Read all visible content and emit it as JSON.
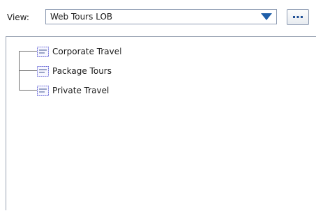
{
  "view": {
    "label": "View:",
    "selected": "Web Tours LOB",
    "more_label": "..."
  },
  "tree": {
    "items": [
      {
        "label": "Corporate Travel",
        "icon": "business-process-icon"
      },
      {
        "label": "Package Tours",
        "icon": "business-process-icon"
      },
      {
        "label": "Private Travel",
        "icon": "business-process-icon"
      }
    ]
  }
}
